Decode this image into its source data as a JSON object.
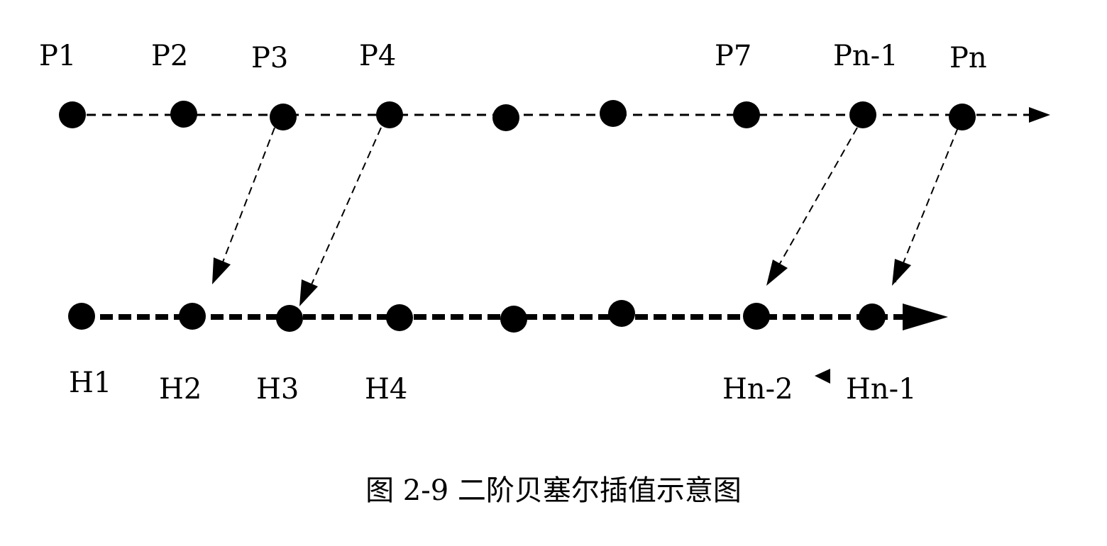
{
  "colors": {
    "ink": "#000000",
    "background": "#ffffff"
  },
  "diagram": {
    "top_row": {
      "labels": [
        "P1",
        "P2",
        "P3",
        "P4",
        "P7",
        "Pn-1",
        "Pn"
      ],
      "point_count": 9,
      "line_style": "thin-dashed",
      "arrow": "right"
    },
    "bottom_row": {
      "labels": [
        "H1",
        "H2",
        "H3",
        "H4",
        "Hn-2",
        "Hn-1"
      ],
      "point_count": 8,
      "line_style": "thick-dashed",
      "arrow": "right"
    },
    "mappings": [
      {
        "from": "P3",
        "to": "H2"
      },
      {
        "from": "P4",
        "to": "H3"
      },
      {
        "from": "Pn-1",
        "to": "Hn-2"
      },
      {
        "from": "Pn",
        "to": "Hn-1"
      }
    ],
    "small_arrow": "left, between Hn-2 and Hn-1"
  },
  "caption": "图 2-9 二阶贝塞尔插值示意图"
}
